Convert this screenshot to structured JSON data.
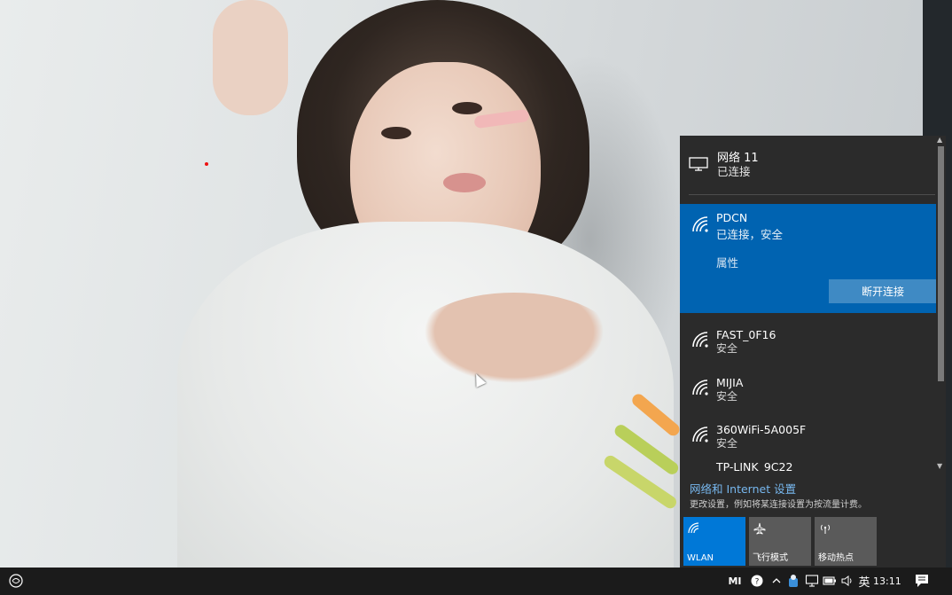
{
  "flyout": {
    "current_network": {
      "name": "网络 11",
      "status": "已连接",
      "icon": "desktop-pc-icon"
    },
    "selected_wifi": {
      "ssid": "PDCN",
      "status": "已连接，安全",
      "properties_label": "属性",
      "disconnect_label": "断开连接"
    },
    "wifi_list": [
      {
        "ssid": "FAST_0F16",
        "status": "安全"
      },
      {
        "ssid": "MIJIA",
        "status": "安全"
      },
      {
        "ssid": "360WiFi-5A005F",
        "status": "安全"
      },
      {
        "ssid": "TP-LINK_9C22",
        "status": ""
      }
    ],
    "settings_link": "网络和 Internet 设置",
    "settings_desc": "更改设置，例如将某连接设置为按流量计费。",
    "quick_actions": [
      {
        "label": "WLAN",
        "icon": "wifi-icon",
        "active": true
      },
      {
        "label": "飞行模式",
        "icon": "airplane-icon",
        "active": false
      },
      {
        "label": "移动热点",
        "icon": "hotspot-icon",
        "active": false
      }
    ],
    "colors": {
      "background": "#2b2b2b",
      "accent": "#0063b1",
      "tile_active": "#0078d7",
      "tile_inactive": "#5a5a5a",
      "link": "#77b7ee"
    }
  },
  "taskbar": {
    "tray_text_mi": "MI",
    "ime_label": "英",
    "clock": "13:11"
  }
}
